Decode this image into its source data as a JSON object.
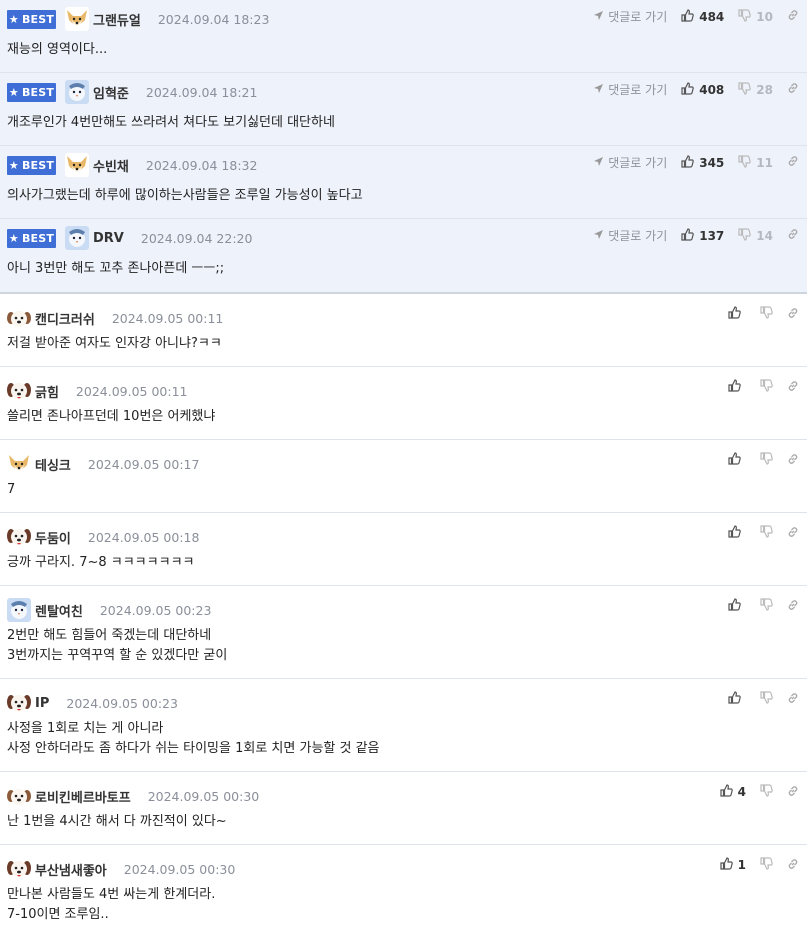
{
  "best_label": "BEST",
  "reply_label": "댓글로 가기",
  "best_comments": [
    {
      "nick": "그랜듀얼",
      "date": "2024.09.04 18:23",
      "text": "재능의 영역이다...",
      "likes": "484",
      "dislikes": "10",
      "avatar": "fox"
    },
    {
      "nick": "임혁준",
      "date": "2024.09.04 18:21",
      "text": "개조루인가 4번만해도 쓰라려서 쳐다도 보기싫던데 대단하네",
      "likes": "408",
      "dislikes": "28",
      "avatar": "bird"
    },
    {
      "nick": "수빈채",
      "date": "2024.09.04 18:32",
      "text": "의사가그랬는데 하루에 많이하는사람들은 조루일 가능성이 높다고",
      "likes": "345",
      "dislikes": "11",
      "avatar": "fox"
    },
    {
      "nick": "DRV",
      "date": "2024.09.04 22:20",
      "text": "아니 3번만 해도 꼬추 존나아픈데 ㅡㅡ;;",
      "likes": "137",
      "dislikes": "14",
      "avatar": "bird"
    }
  ],
  "comments": [
    {
      "nick": "캔디크러쉬",
      "date": "2024.09.05 00:11",
      "lines": [
        "저걸 받아준 여자도 인자강 아니냐?ㅋㅋ"
      ],
      "likes": "",
      "avatar": "dog"
    },
    {
      "nick": "긁힘",
      "date": "2024.09.05 00:11",
      "lines": [
        "쓸리면 존나아프던데 10번은 어케했냐"
      ],
      "likes": "",
      "avatar": "dogred"
    },
    {
      "nick": "테싱크",
      "date": "2024.09.05 00:17",
      "lines": [
        "7"
      ],
      "likes": "",
      "avatar": "fox"
    },
    {
      "nick": "두둠이",
      "date": "2024.09.05 00:18",
      "lines": [
        "긍까 구라지. 7~8 ㅋㅋㅋㅋㅋㅋㅋ"
      ],
      "likes": "",
      "avatar": "dogred"
    },
    {
      "nick": "렌탈여친",
      "date": "2024.09.05 00:23",
      "lines": [
        "2번만 해도 힘들어 죽겠는데 대단하네",
        "3번까지는 꾸역꾸역 할 순 있겠다만 굳이"
      ],
      "likes": "",
      "avatar": "bird"
    },
    {
      "nick": "IP",
      "date": "2024.09.05 00:23",
      "lines": [
        "사정을 1회로 치는 게 아니라",
        "사정 안하더라도 좀 하다가 쉬는 타이밍을 1회로 치면 가능할 것 같음"
      ],
      "likes": "",
      "avatar": "dogred"
    },
    {
      "nick": "로비킨베르바토프",
      "date": "2024.09.05 00:30",
      "lines": [
        "난 1번을 4시간 해서 다 까진적이 있다~"
      ],
      "likes": "4",
      "avatar": "dog"
    },
    {
      "nick": "부산냄새좋아",
      "date": "2024.09.05 00:30",
      "lines": [
        "만나본 사람들도 4번 싸는게 한계더라.",
        "7-10이면 조루임.."
      ],
      "likes": "1",
      "avatar": "dogred"
    }
  ],
  "colors": {
    "badge": "#3f6fd6",
    "best_bg": "#eef2fb",
    "meta": "#8a8f99"
  }
}
